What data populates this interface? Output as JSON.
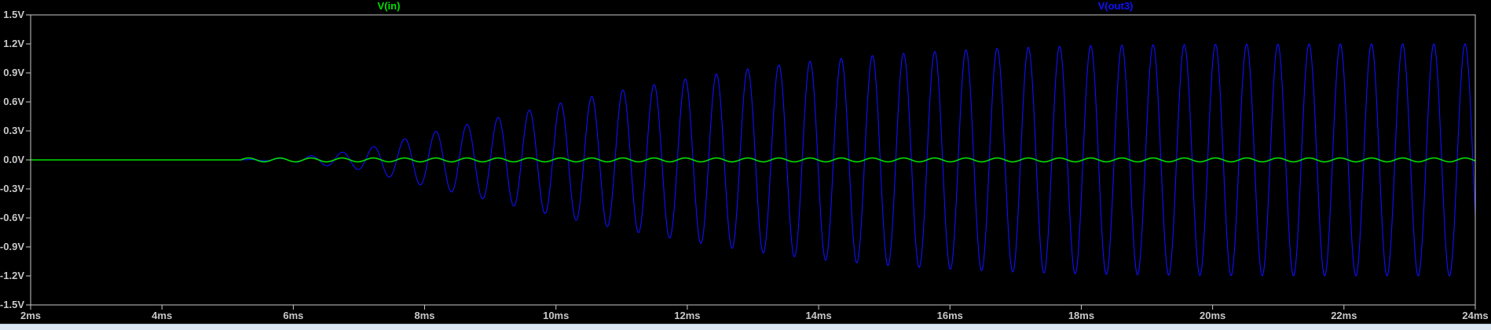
{
  "window": {
    "strip_color": "#dbe8f3"
  },
  "chart_data": {
    "type": "line",
    "title": "",
    "xlabel": "",
    "ylabel": "",
    "xlim": [
      2,
      24
    ],
    "ylim": [
      -1.5,
      1.5
    ],
    "x_unit": "ms",
    "y_unit": "V",
    "x_ticks": [
      "2ms",
      "4ms",
      "6ms",
      "8ms",
      "10ms",
      "12ms",
      "14ms",
      "16ms",
      "18ms",
      "20ms",
      "22ms",
      "24ms"
    ],
    "y_ticks": [
      "1.5V",
      "1.2V",
      "0.9V",
      "0.6V",
      "0.3V",
      "0.0V",
      "-0.3V",
      "-0.6V",
      "-0.9V",
      "-1.2V",
      "-1.5V"
    ],
    "grid": false,
    "background": "#000000",
    "axis_color": "#c8c8c8",
    "series": [
      {
        "name": "V(in)",
        "color": "#00e000",
        "signal": "sine burst starting ≈5.2ms",
        "start_ms": 5.2,
        "period_ms": 0.475,
        "amplitude_v": 0.02
      },
      {
        "name": "V(out3)",
        "color": "#1010ff",
        "signal": "resonant build-up, envelope rising to ≈1.2V",
        "start_ms": 5.2,
        "period_ms": 0.475,
        "envelope_points": [
          [
            5.2,
            0.0
          ],
          [
            6.0,
            0.02
          ],
          [
            7.0,
            0.1
          ],
          [
            8.0,
            0.27
          ],
          [
            9.0,
            0.42
          ],
          [
            10.0,
            0.58
          ],
          [
            11.0,
            0.72
          ],
          [
            12.0,
            0.84
          ],
          [
            13.0,
            0.95
          ],
          [
            14.0,
            1.03
          ],
          [
            15.0,
            1.09
          ],
          [
            16.0,
            1.13
          ],
          [
            17.0,
            1.16
          ],
          [
            18.0,
            1.18
          ],
          [
            19.0,
            1.19
          ],
          [
            20.0,
            1.195
          ],
          [
            22.0,
            1.2
          ],
          [
            24.0,
            1.2
          ]
        ]
      }
    ]
  }
}
